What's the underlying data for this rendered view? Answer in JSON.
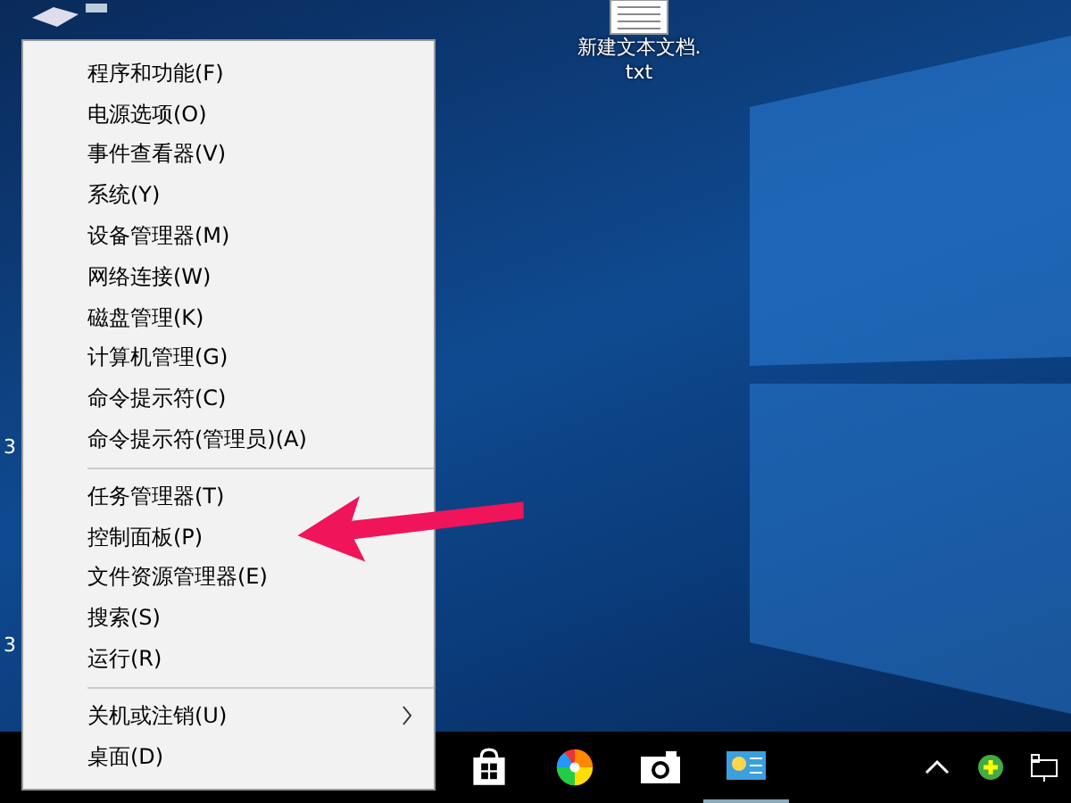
{
  "desktop": {
    "file_icon": {
      "label_lines": [
        "新建文本文档.",
        "txt"
      ]
    },
    "edge_labels": [
      "3",
      "3"
    ]
  },
  "menu": {
    "groups": [
      [
        {
          "label": "程序和功能(F)",
          "submenu": false
        },
        {
          "label": "电源选项(O)",
          "submenu": false
        },
        {
          "label": "事件查看器(V)",
          "submenu": false
        },
        {
          "label": "系统(Y)",
          "submenu": false
        },
        {
          "label": "设备管理器(M)",
          "submenu": false
        },
        {
          "label": "网络连接(W)",
          "submenu": false
        },
        {
          "label": "磁盘管理(K)",
          "submenu": false
        },
        {
          "label": "计算机管理(G)",
          "submenu": false
        },
        {
          "label": "命令提示符(C)",
          "submenu": false
        },
        {
          "label": "命令提示符(管理员)(A)",
          "submenu": false
        }
      ],
      [
        {
          "label": "任务管理器(T)",
          "submenu": false
        },
        {
          "label": "控制面板(P)",
          "submenu": false
        },
        {
          "label": "文件资源管理器(E)",
          "submenu": false
        },
        {
          "label": "搜索(S)",
          "submenu": false
        },
        {
          "label": "运行(R)",
          "submenu": false
        }
      ],
      [
        {
          "label": "关机或注销(U)",
          "submenu": true
        },
        {
          "label": "桌面(D)",
          "submenu": false
        }
      ]
    ]
  }
}
